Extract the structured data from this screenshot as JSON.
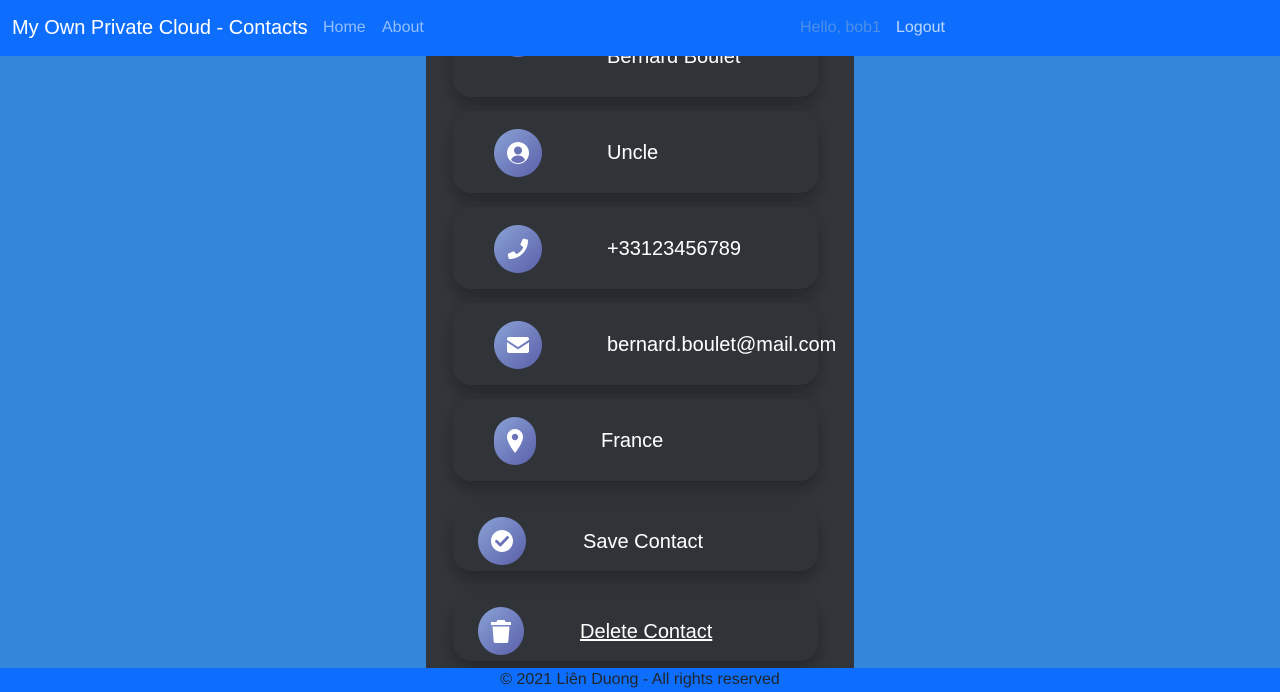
{
  "nav": {
    "brand": "My Own Private Cloud - Contacts",
    "home": "Home",
    "about": "About",
    "greeting": "Hello, bob1",
    "logout": "Logout"
  },
  "contact": {
    "name": "Bernard Boulet",
    "relation": "Uncle",
    "phone": "+33123456789",
    "email": "bernard.boulet@mail.com",
    "country": "France"
  },
  "actions": {
    "save": "Save Contact",
    "delete": "Delete Contact"
  },
  "icons": {
    "name": "sms-icon",
    "relation": "user-circle-icon",
    "phone": "phone-icon",
    "email": "envelope-icon",
    "country": "map-marker-icon",
    "save": "check-circle-icon",
    "delete": "trash-icon"
  },
  "colors": {
    "navbar": "#0d6efd",
    "background": "#3486d9",
    "panel": "#32353a",
    "card": "#303338",
    "icon_gradient_start": "#8aa2d6",
    "icon_gradient_end": "#5a5fa9"
  },
  "footer": {
    "text": "© 2021 Liên Duong - All rights reserved"
  }
}
